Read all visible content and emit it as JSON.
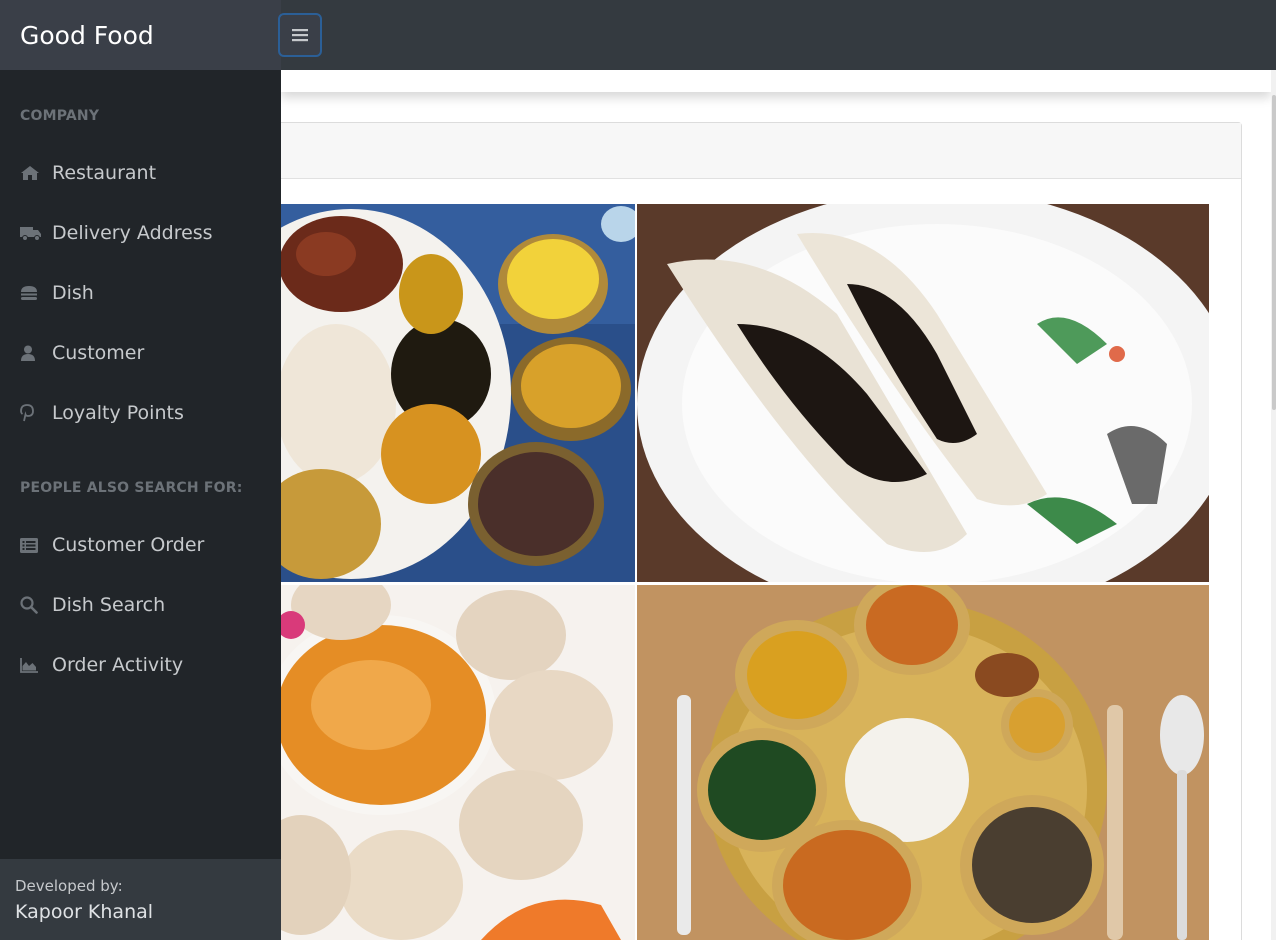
{
  "navbar": {
    "brand": "Good Food",
    "toggle_icon": "hamburger-icon"
  },
  "sidebar": {
    "sections": [
      {
        "heading": "COMPANY",
        "items": [
          {
            "label": "Restaurant",
            "icon": "home-icon"
          },
          {
            "label": "Delivery Address",
            "icon": "truck-icon"
          },
          {
            "label": "Dish",
            "icon": "burger-icon"
          },
          {
            "label": "Customer",
            "icon": "user-icon"
          },
          {
            "label": "Loyalty Points",
            "icon": "pinterest-icon"
          }
        ]
      },
      {
        "heading": "PEOPLE ALSO SEARCH FOR:",
        "items": [
          {
            "label": "Customer Order",
            "icon": "list-alt-icon"
          },
          {
            "label": "Dish Search",
            "icon": "search-icon"
          },
          {
            "label": "Order Activity",
            "icon": "area-chart-icon"
          }
        ]
      }
    ],
    "footer": {
      "label": "Developed by:",
      "name": "Kapoor Khanal"
    }
  },
  "gallery": {
    "images": [
      {
        "name": "nepali-thali-image"
      },
      {
        "name": "yomari-image"
      },
      {
        "name": "momo-image"
      },
      {
        "name": "thali-set-image"
      }
    ]
  },
  "colors": {
    "navbar": "#343a40",
    "sidebar": "#212529",
    "focus_border": "#2b5f97"
  }
}
